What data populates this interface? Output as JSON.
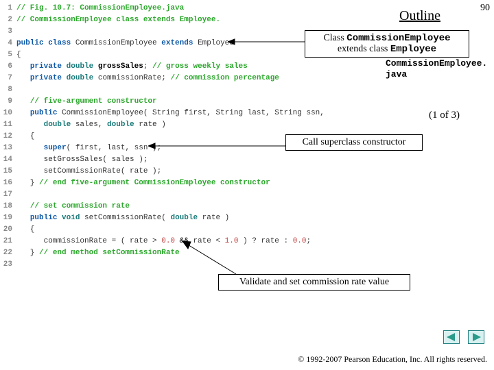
{
  "page_number": "90",
  "outline": "Outline",
  "file_label_1": "CommissionEmployee.",
  "file_label_2": "java",
  "page_of": "(1 of 3)",
  "callouts": {
    "c1_pre": "Class ",
    "c1_mono1": "CommissionEmployee",
    "c1_mid": " extends class ",
    "c1_mono2": "Employee",
    "c2": "Call superclass constructor",
    "c3": "Validate and set commission rate value"
  },
  "nav": {
    "prev": "prev",
    "next": "next"
  },
  "copyright": "© 1992-2007 Pearson Education, Inc.  All rights reserved.",
  "code": [
    {
      "n": "1",
      "tokens": [
        [
          "cmt",
          "// Fig. 10.7: CommissionEmployee.java"
        ]
      ]
    },
    {
      "n": "2",
      "tokens": [
        [
          "cmt",
          "// CommissionEmployee class extends Employee."
        ]
      ]
    },
    {
      "n": "3",
      "tokens": []
    },
    {
      "n": "4",
      "tokens": [
        [
          "kw",
          "public class"
        ],
        [
          "id",
          " CommissionEmployee "
        ],
        [
          "kw",
          "extends"
        ],
        [
          "id",
          " Employee"
        ]
      ]
    },
    {
      "n": "5",
      "tokens": [
        [
          "id",
          "{"
        ]
      ]
    },
    {
      "n": "6",
      "tokens": [
        [
          "id",
          "   "
        ],
        [
          "kw",
          "private"
        ],
        [
          "id",
          " "
        ],
        [
          "typ",
          "double"
        ],
        [
          "id",
          " "
        ],
        [
          "bold",
          "grossSales"
        ],
        [
          "id",
          "; "
        ],
        [
          "cmt",
          "// gross weekly sales"
        ]
      ]
    },
    {
      "n": "7",
      "tokens": [
        [
          "id",
          "   "
        ],
        [
          "kw",
          "private"
        ],
        [
          "id",
          " "
        ],
        [
          "typ",
          "double"
        ],
        [
          "id",
          " commissionRate; "
        ],
        [
          "cmt",
          "// commission percentage"
        ]
      ]
    },
    {
      "n": "8",
      "tokens": []
    },
    {
      "n": "9",
      "tokens": [
        [
          "id",
          "   "
        ],
        [
          "cmt",
          "// five-argument constructor"
        ]
      ]
    },
    {
      "n": "10",
      "tokens": [
        [
          "id",
          "   "
        ],
        [
          "kw",
          "public"
        ],
        [
          "id",
          " CommissionEmployee( String first, String last, String ssn,"
        ]
      ]
    },
    {
      "n": "11",
      "tokens": [
        [
          "id",
          "      "
        ],
        [
          "typ",
          "double"
        ],
        [
          "id",
          " sales, "
        ],
        [
          "typ",
          "double"
        ],
        [
          "id",
          " rate )"
        ]
      ]
    },
    {
      "n": "12",
      "tokens": [
        [
          "id",
          "   {"
        ]
      ]
    },
    {
      "n": "13",
      "tokens": [
        [
          "id",
          "      "
        ],
        [
          "kw",
          "super"
        ],
        [
          "id",
          "( first, last, ssn );"
        ]
      ]
    },
    {
      "n": "14",
      "tokens": [
        [
          "id",
          "      setGrossSales( sales );"
        ]
      ]
    },
    {
      "n": "15",
      "tokens": [
        [
          "id",
          "      setCommissionRate( rate );"
        ]
      ]
    },
    {
      "n": "16",
      "tokens": [
        [
          "id",
          "   } "
        ],
        [
          "cmt",
          "// end five-argument CommissionEmployee constructor"
        ]
      ]
    },
    {
      "n": "17",
      "tokens": []
    },
    {
      "n": "18",
      "tokens": [
        [
          "id",
          "   "
        ],
        [
          "cmt",
          "// set commission rate"
        ]
      ]
    },
    {
      "n": "19",
      "tokens": [
        [
          "id",
          "   "
        ],
        [
          "kw",
          "public"
        ],
        [
          "id",
          " "
        ],
        [
          "typ",
          "void"
        ],
        [
          "id",
          " setCommissionRate( "
        ],
        [
          "typ",
          "double"
        ],
        [
          "id",
          " rate )"
        ]
      ]
    },
    {
      "n": "20",
      "tokens": [
        [
          "id",
          "   {"
        ]
      ]
    },
    {
      "n": "21",
      "tokens": [
        [
          "id",
          "      commissionRate = ( rate > "
        ],
        [
          "lit",
          "0.0"
        ],
        [
          "id",
          " "
        ],
        [
          "op",
          "&&"
        ],
        [
          "id",
          " rate < "
        ],
        [
          "lit",
          "1.0"
        ],
        [
          "id",
          " ) ? rate : "
        ],
        [
          "lit",
          "0.0"
        ],
        [
          "id",
          ";"
        ]
      ]
    },
    {
      "n": "22",
      "tokens": [
        [
          "id",
          "   } "
        ],
        [
          "cmt",
          "// end method setCommissionRate"
        ]
      ]
    },
    {
      "n": "23",
      "tokens": []
    }
  ]
}
